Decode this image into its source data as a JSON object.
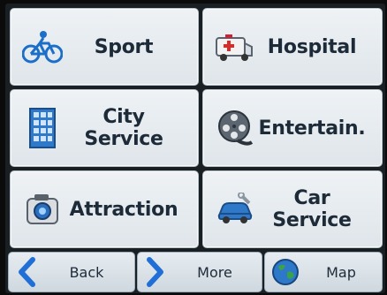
{
  "menu": {
    "items": [
      {
        "label": "Sport",
        "icon": "bicycle-icon"
      },
      {
        "label": "Hospital",
        "icon": "ambulance-icon"
      },
      {
        "label": "City Service",
        "icon": "building-icon"
      },
      {
        "label": "Entertain.",
        "icon": "film-reel-icon"
      },
      {
        "label": "Attraction",
        "icon": "camera-icon"
      },
      {
        "label": "Car Service",
        "icon": "car-wrench-icon"
      }
    ]
  },
  "bottom_bar": {
    "back_label": "Back",
    "more_label": "More",
    "map_label": "Map"
  },
  "colors": {
    "tile_bg": "#e4e9ee",
    "text": "#1d2a38",
    "accent_blue": "#1f6fd6"
  }
}
